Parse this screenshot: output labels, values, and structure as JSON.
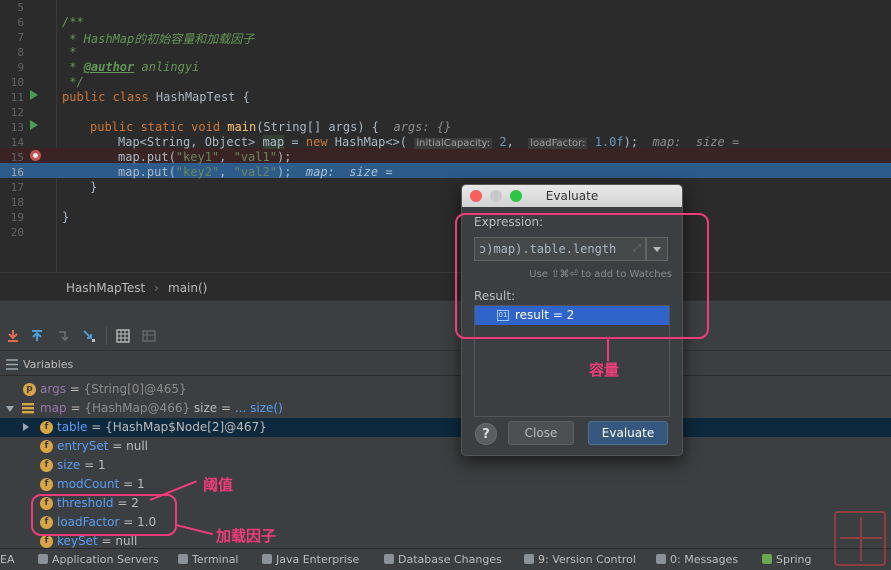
{
  "editor": {
    "line_numbers": [
      "5",
      "6",
      "7",
      "8",
      "9",
      "10",
      "11",
      "12",
      "13",
      "14",
      "15",
      "16",
      "17",
      "18",
      "19",
      "20"
    ],
    "lines": {
      "l6": "/**",
      "l7": " * HashMap的初始容量和加载因子",
      "l8": " *",
      "l9_prefix": " * ",
      "l9_tag": "@author",
      "l9_name": " anlingyi",
      "l10": " */",
      "l11_kw": "public class ",
      "l11_name": "HashMapTest {",
      "l13_kw": "public static void ",
      "l13_fn": "main",
      "l13_rest": "(String[] args) {",
      "l13_hint": "args: {}",
      "l14_type": "Map<String, Object> ",
      "l14_var": "map",
      "l14_eq": " = ",
      "l14_new": "new ",
      "l14_cls": "HashMap<>(",
      "l14_p1": "initialCapacity:",
      "l14_v1": "2",
      "l14_comma": ",",
      "l14_p2": "loadFactor:",
      "l14_v2": "1.0f",
      "l14_end": ");",
      "l14_hint": "map:  size =",
      "l15_pre": "map.put(",
      "l15_s1": "\"key1\"",
      "l15_c": ", ",
      "l15_s2": "\"val1\"",
      "l15_end": ");",
      "l16_pre": "map.put(",
      "l16_s1": "\"key2\"",
      "l16_c": ", ",
      "l16_s2": "\"val2\"",
      "l16_end": ");",
      "l16_hint": "map:  size =",
      "l17": "}",
      "l19": "}"
    }
  },
  "breadcrumb": {
    "cls": "HashMapTest",
    "sep": "›",
    "method": "main()"
  },
  "debug": {
    "variables_title": "Variables",
    "rows": [
      {
        "name": "args",
        "eq": " = ",
        "val": "{String[0]@465}"
      },
      {
        "name": "map",
        "eq": " = ",
        "val": "{HashMap@466}",
        "extra": "  size = ",
        "link": "... size()"
      },
      {
        "name": "table",
        "eq": " = ",
        "val": "{HashMap$Node[2]@467}"
      },
      {
        "name": "entrySet",
        "eq": " = ",
        "val": "null"
      },
      {
        "name": "size",
        "eq": " = ",
        "val": "1"
      },
      {
        "name": "modCount",
        "eq": " = ",
        "val": "1"
      },
      {
        "name": "threshold",
        "eq": " = ",
        "val": "2"
      },
      {
        "name": "loadFactor",
        "eq": " = ",
        "val": "1.0"
      },
      {
        "name": "keySet",
        "eq": " = ",
        "val": "null"
      }
    ]
  },
  "statusbar": {
    "items": [
      "EA",
      "Application Servers",
      "Terminal",
      "Java Enterprise",
      "Database Changes",
      "9: Version Control",
      "0: Messages",
      "Spring"
    ]
  },
  "dialog": {
    "title": "Evaluate",
    "expression_label": "Expression:",
    "expression_value": "ɔ)map).table.length",
    "hint": "Use ⇧⌘⏎ to add to Watches",
    "result_label": "Result:",
    "result_value": "result = 2",
    "result_icon": "01",
    "help": "?",
    "close": "Close",
    "evaluate": "Evaluate"
  },
  "annotations": {
    "capacity": "容量",
    "threshold": "阈值",
    "load_factor": "加载因子"
  },
  "colors": {
    "accent": "#f03c78",
    "selection": "#2f65ca"
  }
}
